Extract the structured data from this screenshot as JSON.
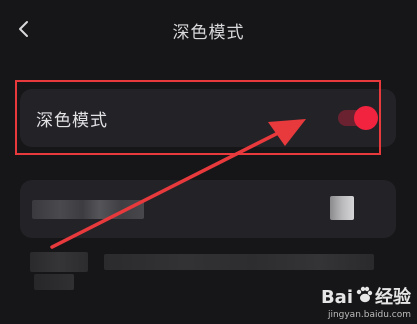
{
  "header": {
    "title": "深色模式",
    "back_icon": "chevron-left-icon"
  },
  "settings": {
    "dark_mode": {
      "label": "深色模式",
      "toggle_on": true,
      "accent_color": "#f2233f"
    }
  },
  "annotation": {
    "highlight_color": "#e8393d",
    "arrow_color": "#e8393d"
  },
  "watermark": {
    "brand_prefix": "Bai",
    "brand_suffix": "经验",
    "url": "jingyan.baidu.com",
    "icon": "paw-icon"
  }
}
